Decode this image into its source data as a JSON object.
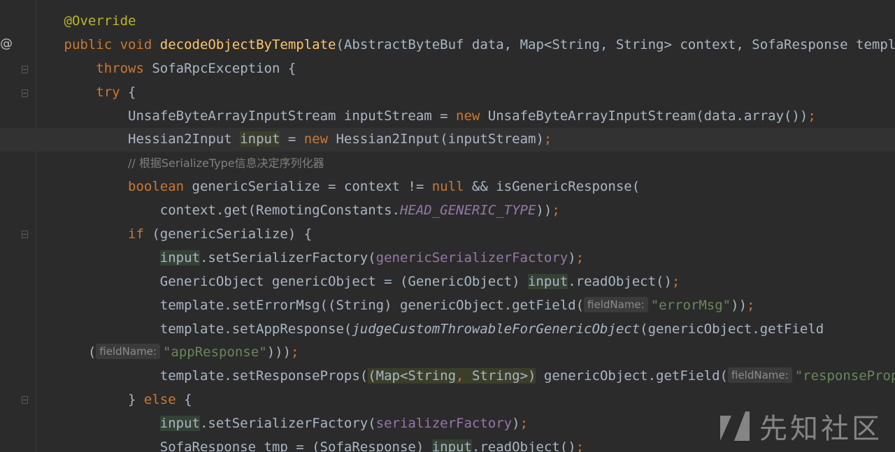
{
  "editor": {
    "language": "java",
    "gutter": {
      "override_marker": "@"
    },
    "lines": [
      {
        "indent": "        ",
        "tokens": [
          {
            "c": "ann",
            "t": "@Override"
          }
        ]
      },
      {
        "indent": "        ",
        "tokens": [
          {
            "c": "kw",
            "t": "public void "
          },
          {
            "c": "fn",
            "t": "decodeObjectByTemplate"
          },
          {
            "c": "",
            "t": "(AbstractByteBuf data, Map<String, String> context, SofaResponse template)"
          }
        ]
      },
      {
        "indent": "            ",
        "tokens": [
          {
            "c": "kw",
            "t": "throws "
          },
          {
            "c": "",
            "t": "SofaRpcException {"
          }
        ]
      },
      {
        "indent": "            ",
        "tokens": [
          {
            "c": "kw",
            "t": "try "
          },
          {
            "c": "",
            "t": "{"
          }
        ]
      },
      {
        "indent": "                ",
        "tokens": [
          {
            "c": "",
            "t": "UnsafeByteArrayInputStream inputStream = "
          },
          {
            "c": "kw",
            "t": "new "
          },
          {
            "c": "",
            "t": "UnsafeByteArrayInputStream(data.array())"
          },
          {
            "c": "kw",
            "t": ";"
          }
        ]
      },
      {
        "indent": "                ",
        "current": true,
        "tokens": [
          {
            "c": "",
            "t": "Hessian2Input "
          },
          {
            "c": "hl-cast",
            "t": "input"
          },
          {
            "c": "",
            "t": " = "
          },
          {
            "c": "kw",
            "t": "new "
          },
          {
            "c": "",
            "t": "Hessian2Input(inputStream)"
          },
          {
            "c": "kw",
            "t": ";"
          }
        ]
      },
      {
        "indent": "                ",
        "tokens": [
          {
            "c": "cmt",
            "t": "// 根据SerializeType信息决定序列化器"
          }
        ]
      },
      {
        "indent": "                ",
        "tokens": [
          {
            "c": "kw",
            "t": "boolean "
          },
          {
            "c": "",
            "t": "genericSerialize = context != "
          },
          {
            "c": "kw",
            "t": "null "
          },
          {
            "c": "",
            "t": "&& isGenericResponse("
          }
        ]
      },
      {
        "indent": "                    ",
        "tokens": [
          {
            "c": "",
            "t": "context.get(RemotingConstants."
          },
          {
            "c": "static",
            "t": "HEAD_GENERIC_TYPE"
          },
          {
            "c": "",
            "t": "))"
          },
          {
            "c": "kw",
            "t": ";"
          }
        ]
      },
      {
        "indent": "                ",
        "tokens": [
          {
            "c": "kw",
            "t": "if "
          },
          {
            "c": "",
            "t": "(genericSerialize) {"
          }
        ]
      },
      {
        "indent": "                    ",
        "tokens": [
          {
            "c": "hl-var",
            "t": "input"
          },
          {
            "c": "",
            "t": ".setSerializerFactory("
          },
          {
            "c": "field",
            "t": "genericSerializerFactory"
          },
          {
            "c": "",
            "t": ")"
          },
          {
            "c": "kw",
            "t": ";"
          }
        ]
      },
      {
        "indent": "                    ",
        "tokens": [
          {
            "c": "",
            "t": "GenericObject genericObject = (GenericObject) "
          },
          {
            "c": "hl-var",
            "t": "input"
          },
          {
            "c": "",
            "t": ".readObject()"
          },
          {
            "c": "kw",
            "t": ";"
          }
        ]
      },
      {
        "indent": "                    ",
        "tokens": [
          {
            "c": "",
            "t": "template.setErrorMsg((String) genericObject.getField("
          },
          {
            "c": "hint",
            "t": "fieldName:"
          },
          {
            "c": "str",
            "t": "\"errorMsg\""
          },
          {
            "c": "",
            "t": "))"
          },
          {
            "c": "kw",
            "t": ";"
          }
        ]
      },
      {
        "indent": "                    ",
        "tokens": [
          {
            "c": "",
            "t": "template.setAppResponse("
          },
          {
            "c": "ital",
            "t": "judgeCustomThrowableForGenericObject"
          },
          {
            "c": "",
            "t": "(genericObject.getField"
          }
        ]
      },
      {
        "indent": "           ",
        "tokens": [
          {
            "c": "",
            "t": "("
          },
          {
            "c": "hint",
            "t": "fieldName:"
          },
          {
            "c": "str",
            "t": "\"appResponse\""
          },
          {
            "c": "",
            "t": ")))"
          },
          {
            "c": "kw",
            "t": ";"
          }
        ]
      },
      {
        "indent": "                    ",
        "tokens": [
          {
            "c": "",
            "t": "template.setResponseProps("
          },
          {
            "c": "hl-cast",
            "t": "(Map<String"
          },
          {
            "c": "hl-cast kw",
            "t": ","
          },
          {
            "c": "hl-cast",
            "t": " String>)"
          },
          {
            "c": "",
            "t": " genericObject.getField("
          },
          {
            "c": "hint",
            "t": "fieldName:"
          },
          {
            "c": "str",
            "t": "\"responseProps\""
          },
          {
            "c": "",
            "t": "))"
          },
          {
            "c": "kw",
            "t": ";"
          }
        ]
      },
      {
        "indent": "                ",
        "tokens": [
          {
            "c": "",
            "t": "} "
          },
          {
            "c": "kw",
            "t": "else "
          },
          {
            "c": "",
            "t": "{"
          }
        ]
      },
      {
        "indent": "                    ",
        "tokens": [
          {
            "c": "hl-var",
            "t": "input"
          },
          {
            "c": "",
            "t": ".setSerializerFactory("
          },
          {
            "c": "field",
            "t": "serializerFactory"
          },
          {
            "c": "",
            "t": ")"
          },
          {
            "c": "kw",
            "t": ";"
          }
        ]
      },
      {
        "indent": "                    ",
        "tokens": [
          {
            "c": "",
            "t": "SofaResponse tmp = (SofaResponse) "
          },
          {
            "c": "hl-var",
            "t": "input"
          },
          {
            "c": "",
            "t": ".readObject()"
          },
          {
            "c": "kw",
            "t": ";"
          }
        ]
      }
    ]
  },
  "watermark": {
    "text": "先知社区"
  },
  "colors": {
    "background": "#2b2b2b",
    "keyword": "#cc7832",
    "annotation": "#bbb529",
    "method": "#ffc66d",
    "string": "#6a8759",
    "field": "#9876aa",
    "plain": "#a9b7c6"
  }
}
